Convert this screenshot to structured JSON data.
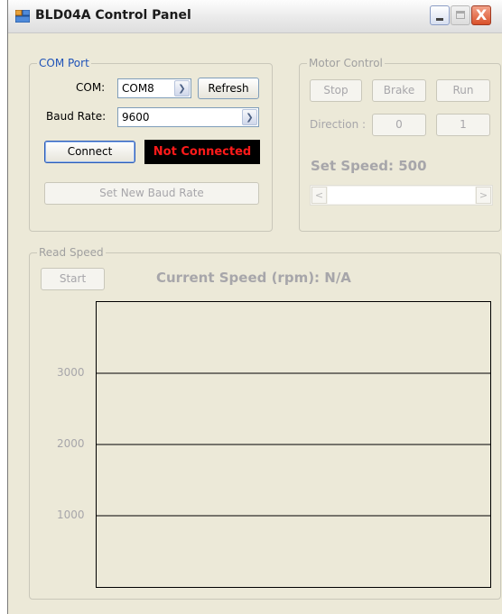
{
  "window": {
    "title": "BLD04A Control Panel",
    "icons": {
      "app": "app-window-icon",
      "minimize": "minimize-icon",
      "maximize": "maximize-icon",
      "close": "close-icon"
    },
    "close_glyph": "X"
  },
  "com_port": {
    "legend": "COM Port",
    "com_label": "COM:",
    "com_value": "COM8",
    "refresh_label": "Refresh",
    "baud_label": "Baud Rate:",
    "baud_value": "9600",
    "connect_label": "Connect",
    "status_text": "Not Connected",
    "status_color": "#ff1a1a",
    "set_baud_label": "Set New Baud Rate"
  },
  "motor_control": {
    "legend": "Motor Control",
    "stop_label": "Stop",
    "brake_label": "Brake",
    "run_label": "Run",
    "direction_label": "Direction :",
    "dir0_label": "0",
    "dir1_label": "1",
    "set_speed_text": "Set Speed: 500",
    "slider_left_glyph": "<",
    "slider_right_glyph": ">"
  },
  "read_speed": {
    "legend": "Read Speed",
    "start_label": "Start",
    "current_speed_text": "Current Speed (rpm): N/A"
  },
  "chart_data": {
    "type": "line",
    "title": "",
    "xlabel": "",
    "ylabel": "",
    "y_ticks": [
      "3000",
      "2000",
      "1000"
    ],
    "gridlines_y": [
      3000,
      2000,
      1000
    ],
    "ylim": [
      0,
      4000
    ],
    "series": []
  }
}
